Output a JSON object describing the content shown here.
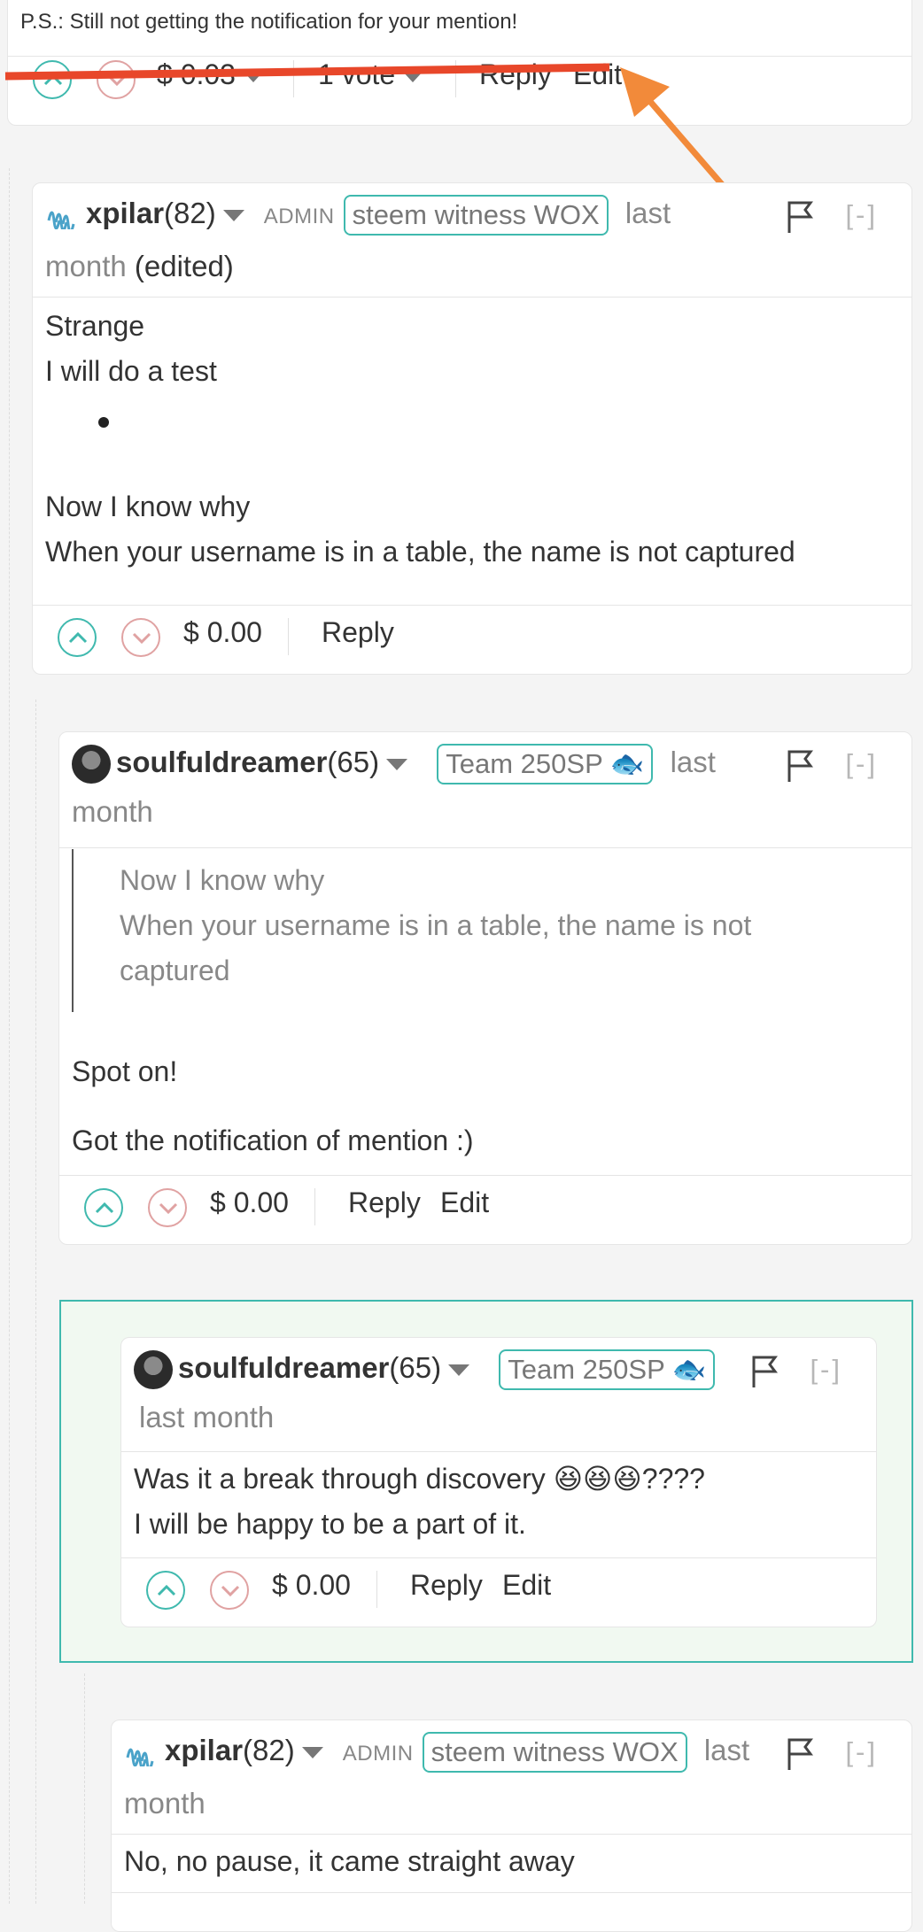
{
  "top_comment": {
    "body": "P.S.: Still not getting the notification for your mention!",
    "payout": "$ 0.03",
    "votes": "1 vote",
    "reply": "Reply",
    "edit": "Edit"
  },
  "annotation": {
    "strike_color": "#e8472a",
    "arrow_color": "#f28a3a"
  },
  "comment1": {
    "author": "xpilar",
    "reputation": "(82)",
    "role": "ADMIN",
    "badge": "steem witness WOX",
    "time_a": "last",
    "time_b": "month",
    "edited": "(edited)",
    "collapse": "[-]",
    "lines": [
      "Strange",
      "I will do a test",
      "Now I know why",
      "When your username is in a table, the name is not captured"
    ],
    "payout": "$ 0.00",
    "reply": "Reply"
  },
  "comment2": {
    "author": "soulfuldreamer",
    "reputation": "(65)",
    "badge": "Team 250SP 🐟",
    "time_a": "last",
    "time_b": "month",
    "collapse": "[-]",
    "quote": [
      "Now I know why",
      "When your username is in a table, the name is not",
      "captured"
    ],
    "lines": [
      "Spot on!",
      "Got the notification of mention :)"
    ],
    "payout": "$ 0.00",
    "reply": "Reply",
    "edit": "Edit"
  },
  "comment3": {
    "author": "soulfuldreamer",
    "reputation": "(65)",
    "badge": "Team 250SP 🐟",
    "time": "last month",
    "collapse": "[-]",
    "lines": [
      "Was it a break through discovery 😆😆😆????",
      "I will be happy to be a part of it."
    ],
    "payout": "$ 0.00",
    "reply": "Reply",
    "edit": "Edit"
  },
  "comment4": {
    "author": "xpilar",
    "reputation": "(82)",
    "role": "ADMIN",
    "badge": "steem witness WOX",
    "time_a": "last",
    "time_b": "month",
    "collapse": "[-]",
    "lines": [
      "No, no pause, it came straight away"
    ]
  },
  "icons": {
    "upvote": "chevron-up-circle-icon",
    "downvote": "chevron-down-circle-icon",
    "flag": "flag-icon",
    "steem": "steem-logo-icon"
  },
  "colors": {
    "accent": "#3fb9ae",
    "downvote": "#e0a2a2",
    "highlight_bg": "#f1f9f1"
  }
}
